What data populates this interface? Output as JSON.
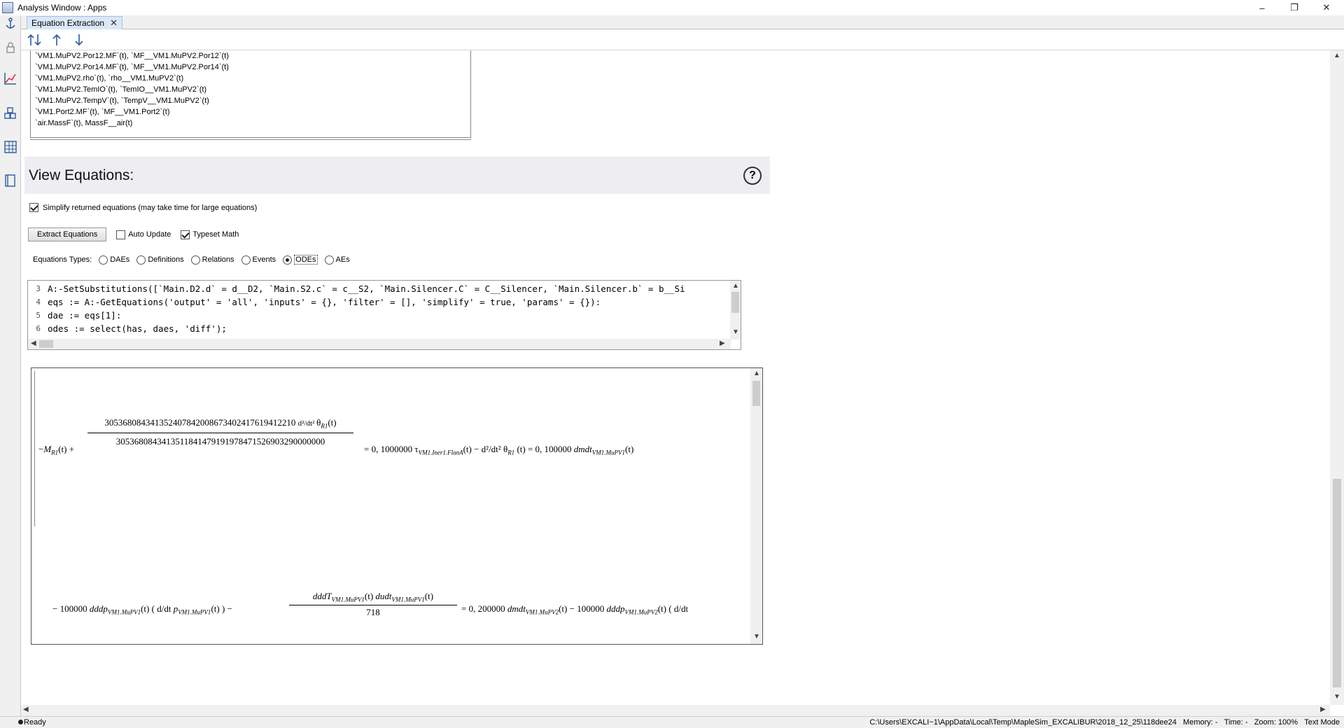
{
  "window": {
    "title": "Analysis Window : Apps",
    "minimize": "–",
    "maximize": "❐",
    "close": "✕"
  },
  "tab": {
    "label": "Equation Extraction",
    "close": "✕"
  },
  "substitutions": [
    "`VM1.MuPV2.Por12.MF`(t),  `MF__VM1.MuPV2.Por12`(t)",
    "`VM1.MuPV2.Por14.MF`(t),  `MF__VM1.MuPV2.Por14`(t)",
    "`VM1.MuPV2.rho`(t),  `rho__VM1.MuPV2`(t)",
    "`VM1.MuPV2.TemIO`(t),  `TemIO__VM1.MuPV2`(t)",
    "`VM1.MuPV2.TempV`(t),  `TempV__VM1.MuPV2`(t)",
    "`VM1.Port2.MF`(t),  `MF__VM1.Port2`(t)",
    "`air.MassF`(t),  MassF__air(t)"
  ],
  "section": {
    "title": "View Equations:",
    "help": "?"
  },
  "options": {
    "simplify_label": "Simplify returned equations (may take time for large equations)",
    "extract_button": "Extract Equations",
    "auto_update": "Auto Update",
    "typeset_math": "Typeset Math"
  },
  "equation_types": {
    "label": "Equations Types:",
    "items": [
      "DAEs",
      "Definitions",
      "Relations",
      "Events",
      "ODEs",
      "AEs"
    ],
    "selected": "ODEs"
  },
  "code": [
    {
      "n": "3",
      "text": "A:-SetSubstitutions([`Main.D2.d` = d__D2, `Main.S2.c` = c__S2, `Main.Silencer.C` = C__Silencer, `Main.Silencer.b` = b__Si"
    },
    {
      "n": "4",
      "text": "eqs := A:-GetEquations('output' = 'all', 'inputs' = {}, 'filter' = [], 'simplify' = true, 'params' = {}):"
    },
    {
      "n": "5",
      "text": "dae := eqs[1]:"
    },
    {
      "n": "6",
      "text": "odes := select(has, daes, 'diff');"
    }
  ],
  "math": {
    "m_r1": "M",
    "r1": "R1",
    "numerator": "305368084341352407842008673402417619412210",
    "denominator": "3053680843413511841479191978471526903290000000",
    "rhs1": "= 0, 1000000",
    "tau": "τ",
    "tau_sub": "VM1.Iner1.FlanA",
    "theta": "θ",
    "rhs2": "(t) = 0, 100000",
    "dmdt": "dmdt",
    "dmdt_sub": "VM1.MuPV1",
    "line2_coef": "− 100000",
    "dddp": "dddp",
    "dddp_sub": "VM1.MuPV1",
    "p_sub": "VM1.MuPV1",
    "frac2_num": "dddT",
    "frac2_num_sub": "VM1.MuPV1",
    "dudt": "dudt",
    "dudt_sub": "VM1.MuPV1",
    "frac2_den": "718",
    "rhs3": "= 0, 200000",
    "dmdt2_sub": "VM1.MuPV2",
    "dddp2_sub": "VM1.MuPV2",
    "dd": "d",
    "dt": "dt",
    "t": "(t)"
  },
  "status": {
    "ready": "Ready",
    "path": "C:\\Users\\EXCALI~1\\AppData\\Local\\Temp\\MapleSim_EXCALIBUR\\2018_12_25\\118dee24",
    "memory": "Memory: -",
    "time": "Time: -",
    "zoom": "Zoom: 100%",
    "mode": "Text Mode"
  }
}
